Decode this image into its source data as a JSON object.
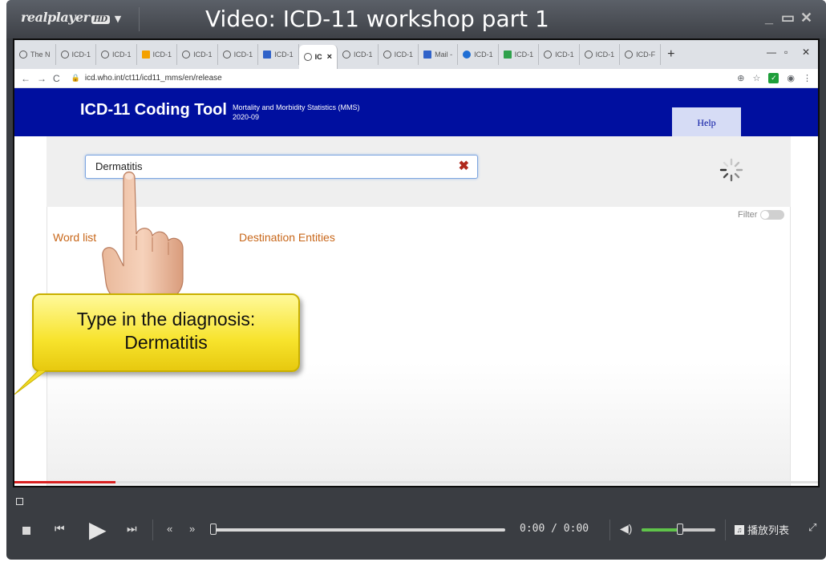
{
  "player": {
    "logo": "realplayer",
    "logo_hd": "HD",
    "logo_caret": "▼",
    "title": "Video: ICD-11 workshop part 1",
    "minimize": "_",
    "maximize": "▭",
    "close": "✕",
    "time": "0:00 / 0:00",
    "playlist_label": "播放列表",
    "volume_fraction": 0.52,
    "playback_fraction": 0.0
  },
  "browser": {
    "tabs": [
      {
        "label": "The N",
        "icon": "who-globe-icon"
      },
      {
        "label": "ICD-1",
        "icon": "globe-icon"
      },
      {
        "label": "ICD-1",
        "icon": "globe-icon"
      },
      {
        "label": "ICD-1",
        "icon": "orange-square-icon"
      },
      {
        "label": "ICD-1",
        "icon": "globe-icon"
      },
      {
        "label": "ICD-1",
        "icon": "globe-icon"
      },
      {
        "label": "ICD-1",
        "icon": "blue-square-icon"
      },
      {
        "label": "IC",
        "icon": "globe-icon",
        "active": true
      },
      {
        "label": "ICD-1",
        "icon": "globe-icon"
      },
      {
        "label": "ICD-1",
        "icon": "globe-icon"
      },
      {
        "label": "Mail -",
        "icon": "outlook-icon"
      },
      {
        "label": "ICD-1",
        "icon": "blue-dot-icon"
      },
      {
        "label": "ICD-1",
        "icon": "green-square-icon"
      },
      {
        "label": "ICD-1",
        "icon": "globe-icon"
      },
      {
        "label": "ICD-1",
        "icon": "globe-icon"
      },
      {
        "label": "ICD-F",
        "icon": "globe-icon"
      }
    ],
    "new_tab": "+",
    "url": "icd.who.int/ct11/icd11_mms/en/release"
  },
  "icd": {
    "title": "ICD-11 Coding Tool",
    "subtitle_line1": "Mortality and Morbidity Statistics (MMS)",
    "subtitle_line2": "2020-09",
    "help_label": "Help",
    "search_value": "Dermatitis",
    "clear_symbol": "✖",
    "filter_label": "Filter",
    "word_list_label": "Word list",
    "destination_label": "Destination Entities"
  },
  "callout": {
    "line1": "Type in the diagnosis:",
    "line2": "Dermatitis"
  },
  "colors": {
    "icd_header": "#000f9f",
    "accent_orange": "#c8671a",
    "callout_yellow": "#f7e32c",
    "progress_red": "#d92020",
    "volume_green": "#5fc44a"
  }
}
